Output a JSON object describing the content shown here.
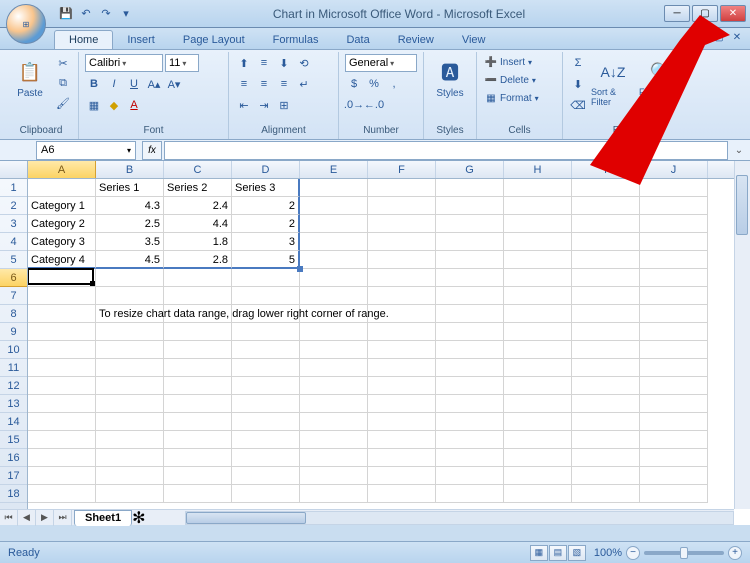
{
  "title": "Chart in Microsoft Office Word - Microsoft Excel",
  "tabs": [
    "Home",
    "Insert",
    "Page Layout",
    "Formulas",
    "Data",
    "Review",
    "View"
  ],
  "active_tab": "Home",
  "ribbon": {
    "clipboard": {
      "label": "Clipboard",
      "paste": "Paste"
    },
    "font": {
      "label": "Font",
      "name": "Calibri",
      "size": "11"
    },
    "alignment": {
      "label": "Alignment"
    },
    "number": {
      "label": "Number",
      "format": "General"
    },
    "styles": {
      "label": "Styles",
      "btn": "Styles"
    },
    "cells": {
      "label": "Cells",
      "insert": "Insert",
      "delete": "Delete",
      "format": "Format"
    },
    "editing": {
      "label": "Editing",
      "sort": "Sort & Filter",
      "find": "Find & Select"
    }
  },
  "namebox": "A6",
  "columns": [
    "A",
    "B",
    "C",
    "D",
    "E",
    "F",
    "G",
    "H",
    "I",
    "J"
  ],
  "rows": [
    1,
    2,
    3,
    4,
    5,
    6,
    7,
    8,
    9,
    10,
    11,
    12,
    13,
    14,
    15,
    16,
    17,
    18
  ],
  "cells": {
    "r1": {
      "B": "Series 1",
      "C": "Series 2",
      "D": "Series 3"
    },
    "r2": {
      "A": "Category 1",
      "B": "4.3",
      "C": "2.4",
      "D": "2"
    },
    "r3": {
      "A": "Category 2",
      "B": "2.5",
      "C": "4.4",
      "D": "2"
    },
    "r4": {
      "A": "Category 3",
      "B": "3.5",
      "C": "1.8",
      "D": "3"
    },
    "r5": {
      "A": "Category 4",
      "B": "4.5",
      "C": "2.8",
      "D": "5"
    },
    "r8": {
      "B": "To resize chart data range, drag lower right corner of range."
    }
  },
  "active_cell": "A6",
  "sheet": "Sheet1",
  "status": "Ready",
  "zoom": "100%",
  "chart_data": {
    "type": "table",
    "categories": [
      "Category 1",
      "Category 2",
      "Category 3",
      "Category 4"
    ],
    "series": [
      {
        "name": "Series 1",
        "values": [
          4.3,
          2.5,
          3.5,
          4.5
        ]
      },
      {
        "name": "Series 2",
        "values": [
          2.4,
          4.4,
          1.8,
          2.8
        ]
      },
      {
        "name": "Series 3",
        "values": [
          2,
          2,
          3,
          5
        ]
      }
    ],
    "note": "To resize chart data range, drag lower right corner of range."
  }
}
